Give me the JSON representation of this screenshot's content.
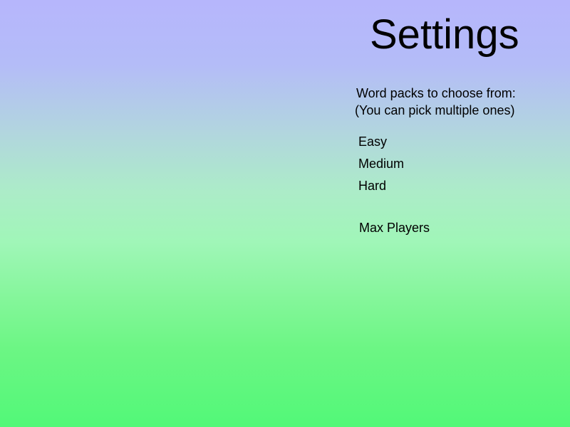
{
  "page": {
    "title": "Settings"
  },
  "word_packs": {
    "heading_line1": "Word packs to choose from:",
    "heading_line2": "(You can pick multiple ones)",
    "options": [
      {
        "label": "Easy"
      },
      {
        "label": "Medium"
      },
      {
        "label": "Hard"
      }
    ]
  },
  "players": {
    "max_label": "Max Players"
  },
  "colors": {
    "background_top": "#b6b6fc",
    "background_bottom": "#52f878",
    "text": "#000000"
  }
}
